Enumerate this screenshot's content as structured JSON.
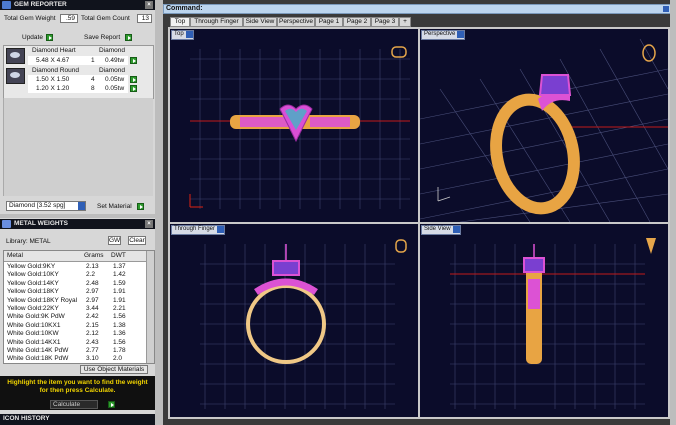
{
  "gem_reporter": {
    "title": "GEM REPORTER",
    "total_weight_label": "Total Gem Weight",
    "total_weight_value": ".59",
    "total_count_label": "Total Gem Count",
    "total_count_value": "13",
    "update_label": "Update",
    "save_report_label": "Save Report",
    "gems": [
      {
        "shape": "Diamond Heart",
        "material": "Diamond",
        "size": "5.48 X 4.67",
        "count": "1",
        "weight": "0.49tw"
      },
      {
        "shape": "Diamond Round",
        "material": "Diamond",
        "size": "1.50 X 1.50",
        "count": "4",
        "weight": "0.05tw",
        "size2": "1.20 X 1.20",
        "count2": "8",
        "weight2": "0.05tw"
      }
    ],
    "material_select": "Diamond    [3.52 spg]",
    "set_material_label": "Set Material"
  },
  "metal_weights": {
    "title": "METAL WEIGHTS",
    "library_label": "Library: METAL",
    "btn_gw": "GW",
    "btn_clear": "Clear",
    "columns": [
      "Metal",
      "Grams",
      "DWT"
    ],
    "rows": [
      [
        "Yellow Gold:9KY",
        "2.13",
        "1.37"
      ],
      [
        "Yellow Gold:10KY",
        "2.2",
        "1.42"
      ],
      [
        "Yellow Gold:14KY",
        "2.48",
        "1.59"
      ],
      [
        "Yellow Gold:18KY",
        "2.97",
        "1.91"
      ],
      [
        "Yellow Gold:18KY Royal",
        "2.97",
        "1.91"
      ],
      [
        "Yellow Gold:22KY",
        "3.44",
        "2.21"
      ],
      [
        "White Gold:9K PdW",
        "2.42",
        "1.56"
      ],
      [
        "White Gold:10KX1",
        "2.15",
        "1.38"
      ],
      [
        "White Gold:10KW",
        "2.12",
        "1.36"
      ],
      [
        "White Gold:14KX1",
        "2.43",
        "1.56"
      ],
      [
        "White Gold:14K PdW",
        "2.77",
        "1.78"
      ],
      [
        "White Gold:18K PdW",
        "3.10",
        "2.0"
      ]
    ],
    "use_object_materials": "Use Object Materials",
    "hint_line1": "Highlight the item you want to find the weight",
    "hint_line2": "for then press Calculate.",
    "calculate_label": "Calculate"
  },
  "icon_history": {
    "title": "ICON HISTORY"
  },
  "command": {
    "label": "Command:"
  },
  "tabs": [
    "Top",
    "Through Finger",
    "Side View",
    "Perspective",
    "Page 1",
    "Page 2",
    "Page 3",
    "+"
  ],
  "viewports": {
    "top": "Top",
    "perspective": "Perspective",
    "through_finger": "Through Finger",
    "side_view": "Side View"
  },
  "colors": {
    "viewport_bg": "#0b0c2a",
    "grid": "#4a4f7a",
    "gold": "#e6a64a",
    "magenta": "#d94fd6",
    "accent_green": "#2d9a2d"
  }
}
